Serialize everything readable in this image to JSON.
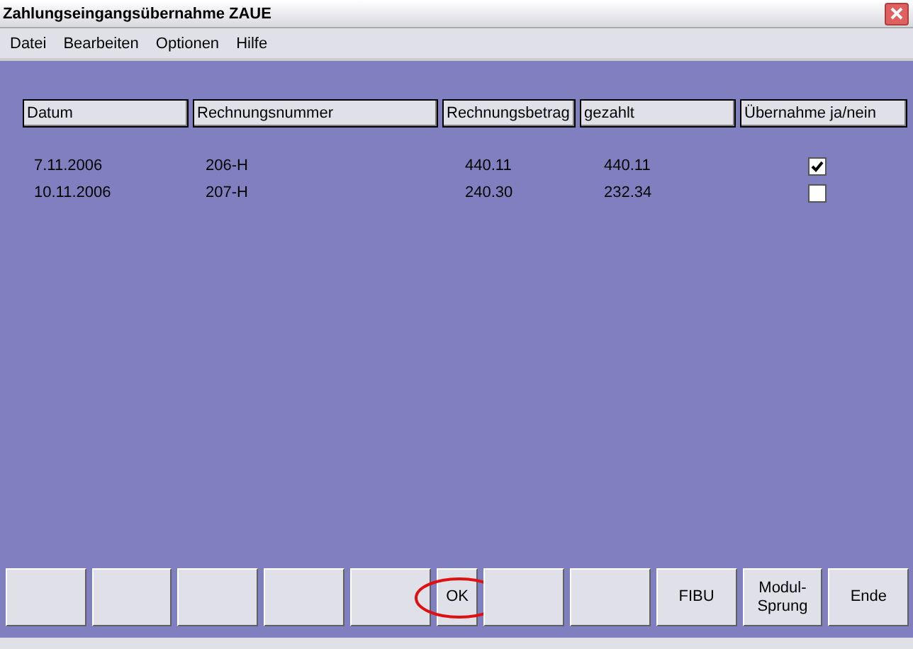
{
  "window": {
    "title": "Zahlungseingangsübernahme ZAUE"
  },
  "menu": [
    "Datei",
    "Bearbeiten",
    "Optionen",
    "Hilfe"
  ],
  "table": {
    "columns": [
      "Datum",
      "Rechnungsnummer",
      "Rechnungsbetrag",
      "gezahlt",
      "Übernahme ja/nein"
    ],
    "rows": [
      {
        "date": "7.11.2006",
        "number": "206-H",
        "amount": "440.11",
        "paid": "440.11",
        "checked": true
      },
      {
        "date": "10.11.2006",
        "number": "207-H",
        "amount": "240.30",
        "paid": "232.34",
        "checked": false
      }
    ]
  },
  "buttons": [
    {
      "highlighted": false
    },
    {
      "highlighted": false
    },
    {
      "highlighted": false
    },
    {
      "highlighted": false
    },
    {
      "highlighted": false
    },
    {
      "label": "OK",
      "highlighted": true
    },
    {
      "highlighted": false
    },
    {
      "highlighted": false
    },
    {
      "label": "FIBU",
      "highlighted": false
    },
    {
      "label": "Modul-\nSprung",
      "highlighted": false
    },
    {
      "label": "Ende",
      "highlighted": false
    }
  ]
}
